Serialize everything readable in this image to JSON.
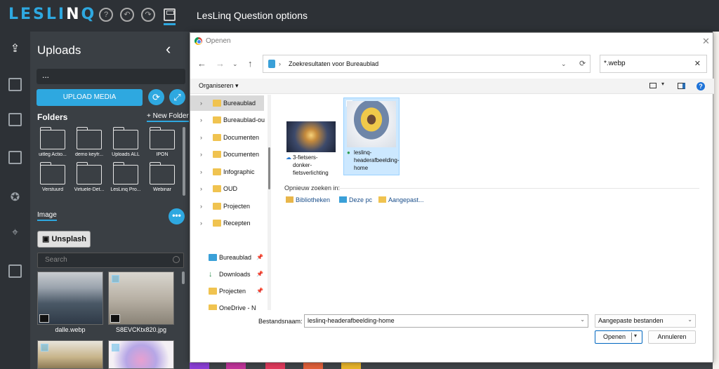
{
  "app": {
    "logo": "LESLINQ",
    "title": "LesLinq Question options"
  },
  "panel": {
    "title": "Uploads",
    "url_value": "...",
    "upload_button": "UPLOAD MEDIA",
    "folders_heading": "Folders",
    "new_folder": "+ New Folder",
    "folders": [
      "uitleg Actio...",
      "demo keyfr...",
      "Uploads ALL",
      "IPON",
      "Verstuurd",
      "Virtuele-Det...",
      "LesLinq Pro...",
      "Webinar"
    ],
    "image_tab": "Image",
    "more_button": "•••",
    "unsplash_button": "Unsplash",
    "search_placeholder": "Search",
    "thumbnails": [
      {
        "caption": "dalle.webp"
      },
      {
        "caption": "S8EVCKtx820.jpg"
      }
    ]
  },
  "swatch_colors": [
    "#8b3fd6",
    "#c0359a",
    "#e03a5c",
    "#e0603a",
    "#e8b42a"
  ],
  "dialog": {
    "title": "Openen",
    "address": "Zoekresultaten voor Bureaublad",
    "search_value": "*.webp",
    "organize": "Organiseren",
    "nav_items": [
      {
        "label": "Bureaublad",
        "selected": true
      },
      {
        "label": "Bureaublad-ou"
      },
      {
        "label": "Documenten"
      },
      {
        "label": "Documenten"
      },
      {
        "label": "Infographic"
      },
      {
        "label": "OUD"
      },
      {
        "label": "Projecten"
      },
      {
        "label": "Recepten"
      }
    ],
    "quick_access": [
      {
        "label": "Bureaublad"
      },
      {
        "label": "Downloads"
      },
      {
        "label": "Projecten"
      },
      {
        "label": "OneDrive - N"
      }
    ],
    "files": [
      {
        "label": "3-fietsers-donker-fietsverlichting",
        "status": "cloud"
      },
      {
        "label": "leslinq-headerafbeelding-home",
        "status": "synced",
        "selected": true
      }
    ],
    "search_again": "Opnieuw zoeken in:",
    "locations": [
      "Bibliotheken",
      "Deze pc",
      "Aangepast..."
    ],
    "filename_label": "Bestandsnaam:",
    "filename_value": "leslinq-headerafbeelding-home",
    "filetype": "Aangepaste bestanden",
    "open_button": "Openen",
    "cancel_button": "Annuleren"
  }
}
